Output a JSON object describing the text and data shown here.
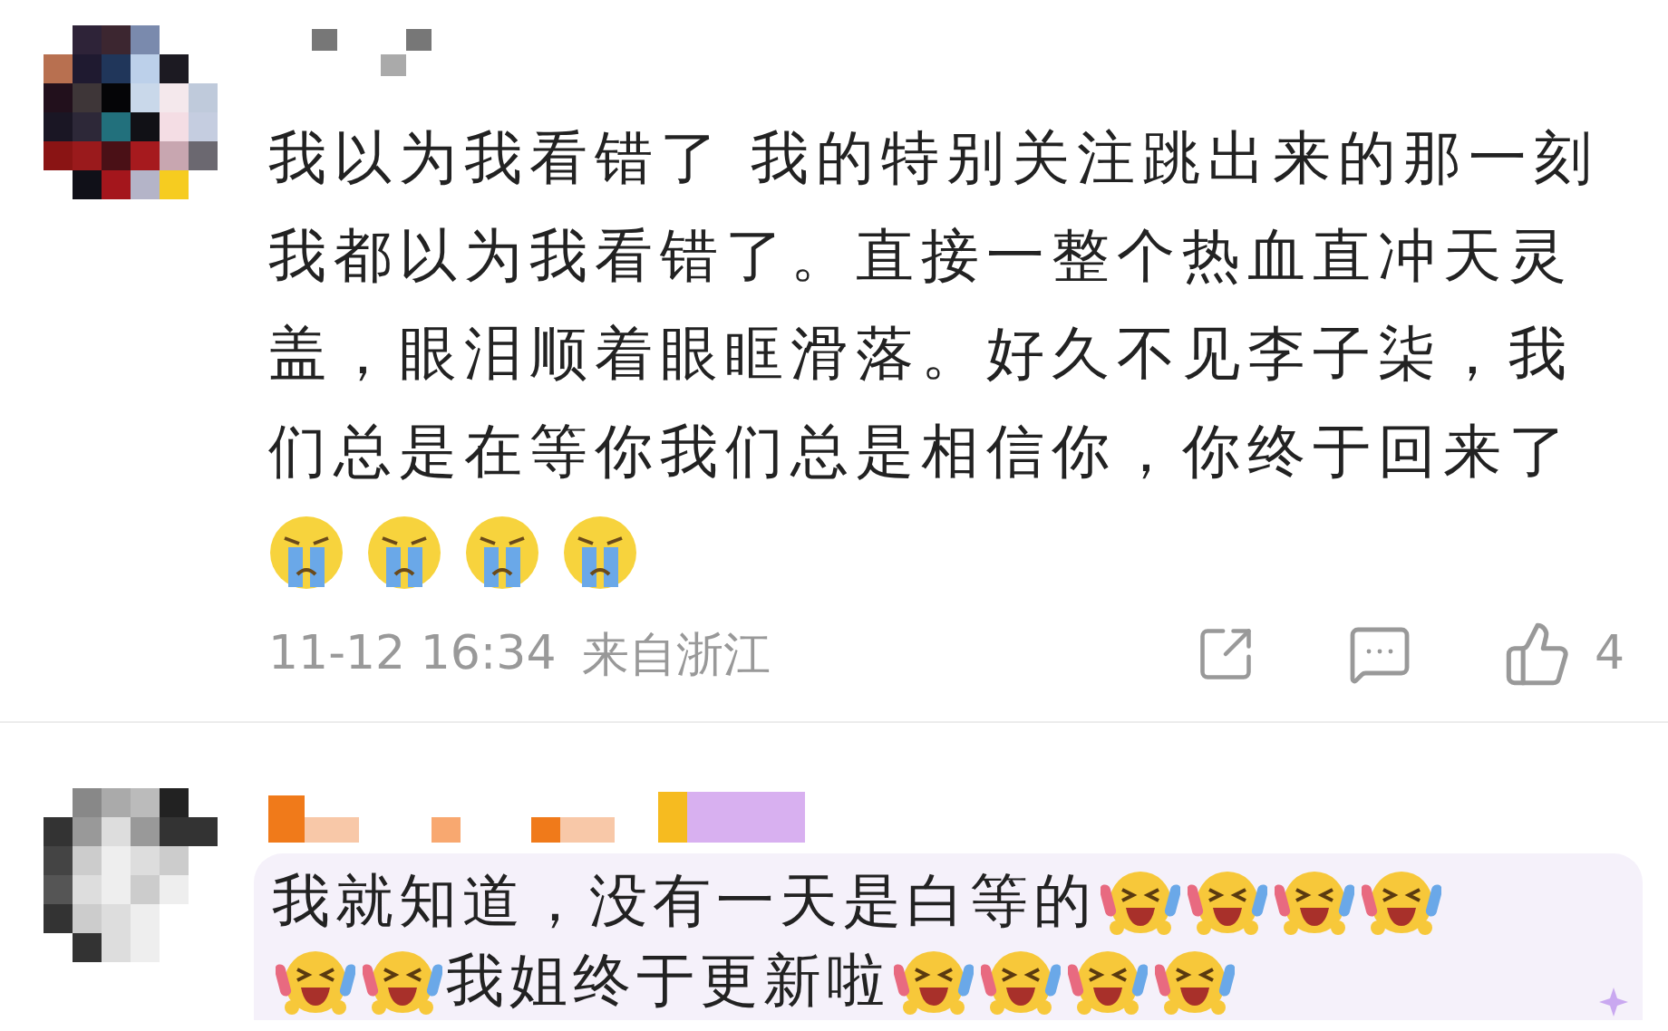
{
  "comments": [
    {
      "body": [
        {
          "kind": "text",
          "text": "我以为我看错了 我的特别关注跳出来的那一刻我都以为我看错了。直接一整个热血直冲天灵盖，眼泪顺着眼眶滑落。好久不见李子柒，我们总是在等你我们总是相信你，你终于回来了"
        },
        {
          "kind": "break"
        },
        {
          "kind": "cry"
        },
        {
          "kind": "cry"
        },
        {
          "kind": "cry"
        },
        {
          "kind": "cry"
        }
      ],
      "time": "11-12 16:34",
      "location": "来自浙江",
      "likes": "4",
      "highlighted": false
    },
    {
      "body": [
        {
          "kind": "text",
          "text": "我就知道，没有一天是白等的"
        },
        {
          "kind": "laugh"
        },
        {
          "kind": "laugh"
        },
        {
          "kind": "laugh"
        },
        {
          "kind": "laugh"
        },
        {
          "kind": "laugh"
        },
        {
          "kind": "laugh"
        },
        {
          "kind": "text",
          "text": "我姐终于更新啦"
        },
        {
          "kind": "laugh"
        },
        {
          "kind": "laugh"
        },
        {
          "kind": "laugh"
        },
        {
          "kind": "laugh"
        }
      ],
      "highlighted": true
    }
  ]
}
